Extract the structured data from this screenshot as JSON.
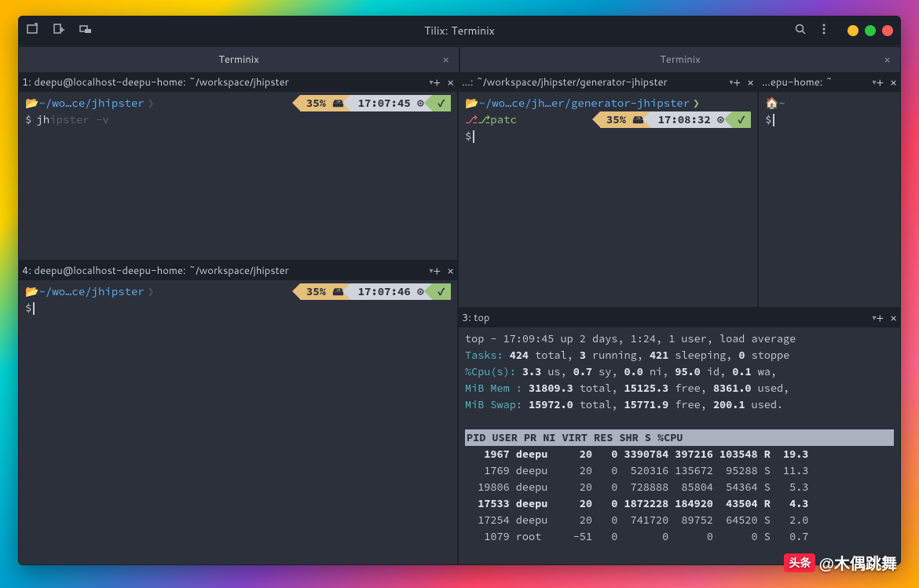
{
  "titlebar": {
    "title": "Tilix: Terminix"
  },
  "session_tabs": [
    {
      "label": "Terminix"
    },
    {
      "label": "Terminix"
    }
  ],
  "panes": {
    "p1": {
      "header": "1: deepu@localhost-deepu-home: ~/workspace/jhipster",
      "path": "~/wo…ce/jhipster",
      "battery": "35% 🖴",
      "time": "17:07:45 ⊙",
      "check": "✓",
      "prompt": "$",
      "typed": "jh",
      "ghost": "ipster -v"
    },
    "p2": {
      "header": "…: ~/workspace/jhipster/generator-jhipster",
      "path": "~/wo…ce/jh…er/generator-jhipster",
      "branch": "patc",
      "battery": "35% 🖴",
      "time": "17:08:32 ⊙",
      "check": "✓",
      "prompt": "$"
    },
    "p5": {
      "header": "…epu-home: ~",
      "home": "~",
      "prompt": "$"
    },
    "p4": {
      "header": "4: deepu@localhost-deepu-home: ~/workspace/jhipster",
      "path": "~/wo…ce/jhipster",
      "battery": "35% 🖴",
      "time": "17:07:46 ⊙",
      "check": "✓",
      "prompt": "$"
    },
    "p3": {
      "header": "3: top",
      "top_summary": {
        "line1_a": "top - 17:09:45 up 2 days,  1:24,  1 user,  load average",
        "line2_label": "Tasks:",
        "line2_total": "424",
        "line2_mid": " total,   ",
        "line2_run": "3",
        "line2_mid2": " running, ",
        "line2_sleep": "421",
        "line2_mid3": " sleeping,   ",
        "line2_stop": "0",
        "line2_end": " stoppe",
        "line3_label": "%Cpu(s):",
        "line3_us": "3.3",
        "line3_us_l": " us,  ",
        "line3_sy": "0.7",
        "line3_sy_l": " sy,  ",
        "line3_ni": "0.0",
        "line3_ni_l": " ni, ",
        "line3_id": "95.0",
        "line3_id_l": " id,  ",
        "line3_wa": "0.1",
        "line3_wa_l": " wa,",
        "line4_label": "MiB Mem :",
        "line4_total": "31809.3",
        "line4_total_l": " total,  ",
        "line4_free": "15125.3",
        "line4_free_l": " free,   ",
        "line4_used": "8361.0",
        "line4_used_l": " used,",
        "line5_label": "MiB Swap:",
        "line5_total": "15972.0",
        "line5_total_l": " total,  ",
        "line5_free": "15771.9",
        "line5_free_l": " free,    ",
        "line5_used": "200.1",
        "line5_used_l": " used."
      },
      "top_header": "    PID USER      PR  NI    VIRT    RES    SHR S  %CPU",
      "top_rows": [
        {
          "pid": "1967",
          "user": "deepu",
          "pr": "20",
          "ni": "0",
          "virt": "3390784",
          "res": "397216",
          "shr": "103548",
          "s": "R",
          "cpu": "19.3",
          "bold": true
        },
        {
          "pid": "1769",
          "user": "deepu",
          "pr": "20",
          "ni": "0",
          "virt": "520316",
          "res": "135672",
          "shr": "95288",
          "s": "S",
          "cpu": "11.3",
          "bold": false
        },
        {
          "pid": "19806",
          "user": "deepu",
          "pr": "20",
          "ni": "0",
          "virt": "728888",
          "res": "85804",
          "shr": "54364",
          "s": "S",
          "cpu": "5.3",
          "bold": false
        },
        {
          "pid": "17533",
          "user": "deepu",
          "pr": "20",
          "ni": "0",
          "virt": "1872228",
          "res": "184920",
          "shr": "43504",
          "s": "R",
          "cpu": "4.3",
          "bold": true
        },
        {
          "pid": "17254",
          "user": "deepu",
          "pr": "20",
          "ni": "0",
          "virt": "741720",
          "res": "89752",
          "shr": "64520",
          "s": "S",
          "cpu": "2.0",
          "bold": false
        },
        {
          "pid": "1079",
          "user": "root",
          "pr": "-51",
          "ni": "0",
          "virt": "0",
          "res": "0",
          "shr": "0",
          "s": "S",
          "cpu": "0.7",
          "bold": false
        }
      ]
    }
  },
  "watermark": {
    "prefix": "头条",
    "handle": "@木偶跳舞"
  }
}
